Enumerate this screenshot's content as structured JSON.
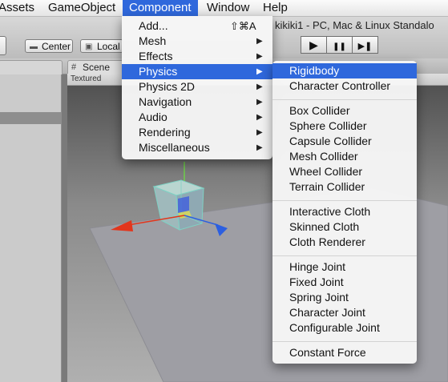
{
  "menubar": {
    "items": [
      {
        "label": "Assets"
      },
      {
        "label": "GameObject"
      },
      {
        "label": "Component"
      },
      {
        "label": "Window"
      },
      {
        "label": "Help"
      }
    ]
  },
  "window_title": "kikiki1 - PC, Mac & Linux Standalo",
  "toolbar": {
    "center_label": "Center",
    "local_label": "Local",
    "play_icon": "▶",
    "pause_icon": "❚❚",
    "step_icon": "▶❚"
  },
  "scene": {
    "tab_label": "Scene",
    "render_mode": "Textured"
  },
  "component_menu": {
    "items": [
      {
        "label": "Add...",
        "shortcut": "⇧⌘A"
      },
      {
        "label": "Mesh",
        "submenu": true
      },
      {
        "label": "Effects",
        "submenu": true
      },
      {
        "label": "Physics",
        "submenu": true,
        "highlighted": true
      },
      {
        "label": "Physics 2D",
        "submenu": true
      },
      {
        "label": "Navigation",
        "submenu": true
      },
      {
        "label": "Audio",
        "submenu": true
      },
      {
        "label": "Rendering",
        "submenu": true
      },
      {
        "label": "Miscellaneous",
        "submenu": true
      }
    ]
  },
  "physics_submenu": {
    "groups": [
      [
        "Rigidbody",
        "Character Controller"
      ],
      [
        "Box Collider",
        "Sphere Collider",
        "Capsule Collider",
        "Mesh Collider",
        "Wheel Collider",
        "Terrain Collider"
      ],
      [
        "Interactive Cloth",
        "Skinned Cloth",
        "Cloth Renderer"
      ],
      [
        "Hinge Joint",
        "Fixed Joint",
        "Spring Joint",
        "Character Joint",
        "Configurable Joint"
      ],
      [
        "Constant Force"
      ]
    ],
    "highlighted": "Rigidbody"
  },
  "colors": {
    "highlight": "#2f68dc",
    "x_axis": "#e2361c",
    "z_axis": "#2c5fe0",
    "y_axis": "#6fcf4a"
  }
}
